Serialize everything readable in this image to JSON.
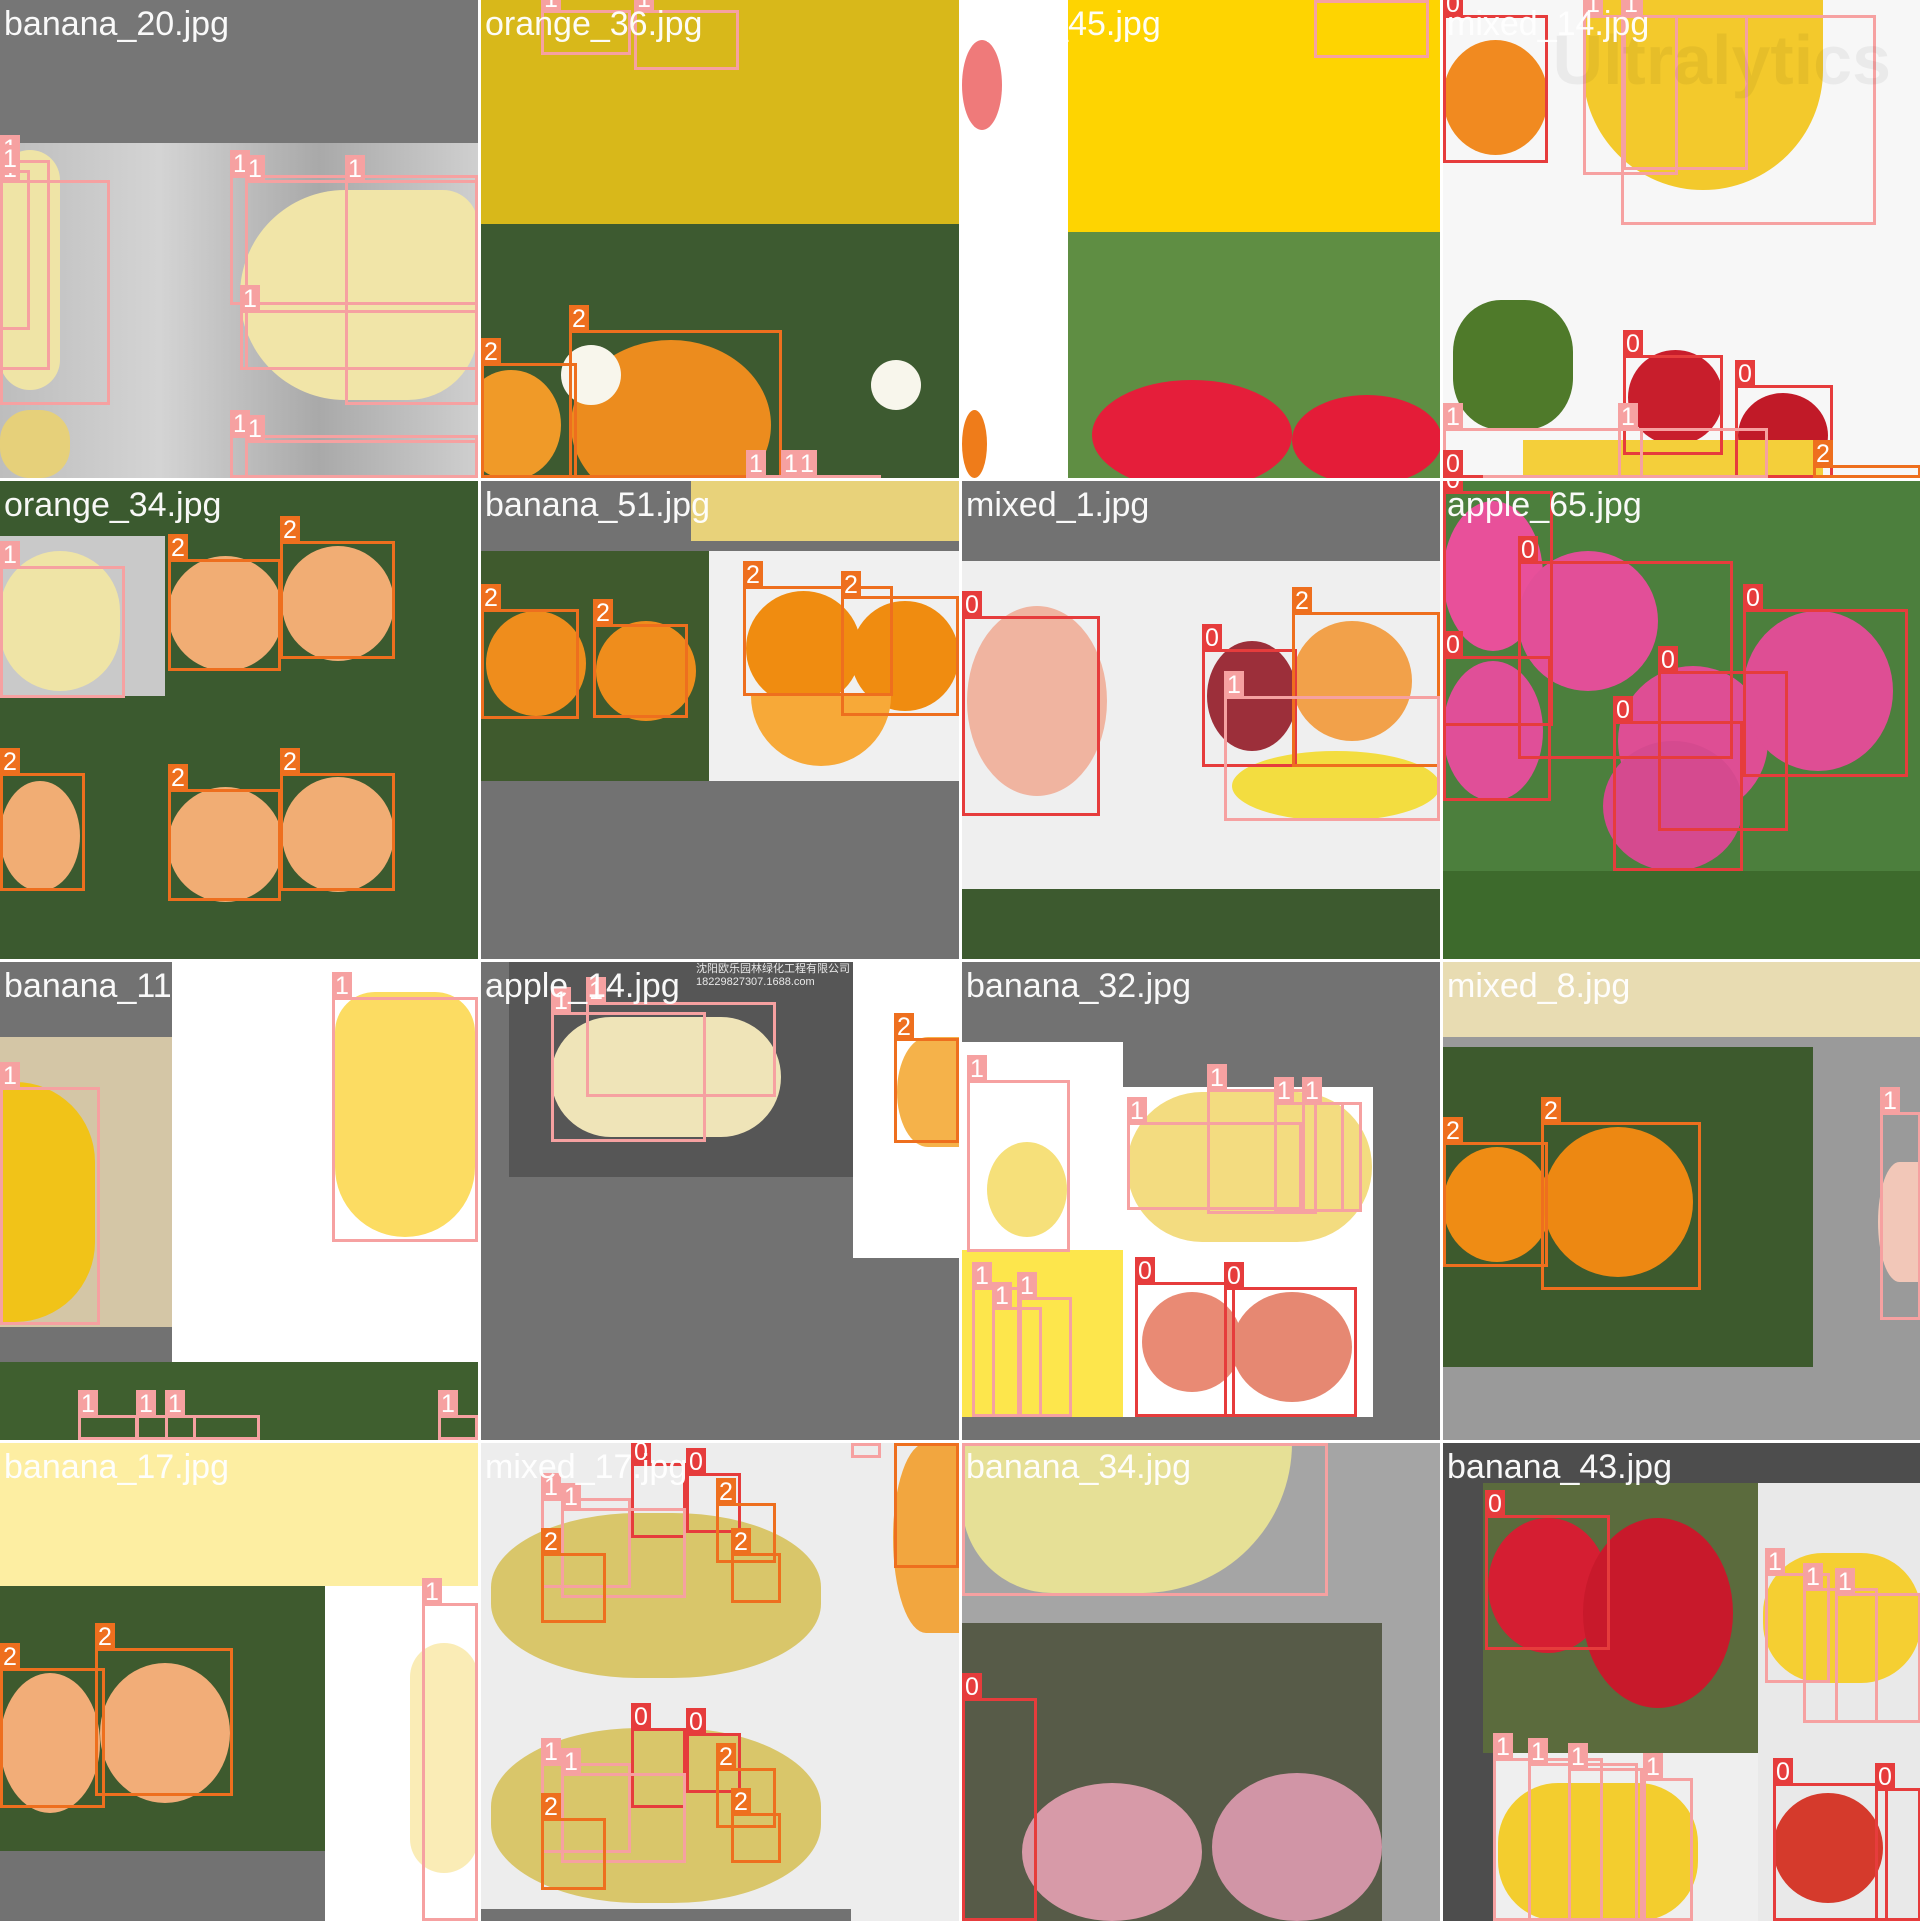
{
  "mosaic": {
    "watermark": "Ultralytics",
    "class_colors": {
      "0": "#e63c3c",
      "1": "#f6a1a1",
      "2": "#ee6f1e"
    },
    "tiles": [
      {
        "title": "banana_20.jpg",
        "labels": [
          "1",
          "1",
          "1",
          "1",
          "1",
          "1",
          "1",
          "1",
          "1"
        ]
      },
      {
        "title": "orange_36.jpg",
        "labels": [
          "1",
          "1",
          "2",
          "2",
          "1",
          "1",
          "1"
        ]
      },
      {
        "title": "apple_45.jpg",
        "labels": [
          "1"
        ]
      },
      {
        "title": "mixed_14.jpg",
        "labels": [
          "0",
          "1",
          "1",
          "1",
          "0",
          "0",
          "1",
          "1",
          "2",
          "0"
        ]
      },
      {
        "title": "orange_34.jpg",
        "labels": [
          "1",
          "2",
          "2",
          "2",
          "2",
          "2"
        ]
      },
      {
        "title": "banana_51.jpg",
        "labels": [
          "2",
          "2",
          "2",
          "2"
        ]
      },
      {
        "title": "mixed_1.jpg",
        "labels": [
          "0",
          "0",
          "2",
          "1"
        ]
      },
      {
        "title": "apple_65.jpg",
        "labels": [
          "0",
          "0",
          "0",
          "0",
          "0",
          "0"
        ]
      },
      {
        "title": "banana_11.jpg",
        "labels": [
          "1",
          "1",
          "1",
          "1",
          "1",
          "1"
        ]
      },
      {
        "title": "apple_14.jpg",
        "sign_line1": "沈阳欧乐园林绿化工程有限公司",
        "sign_line2": "18229827307.1688.com",
        "labels": [
          "1",
          "1",
          "2"
        ]
      },
      {
        "title": "banana_32.jpg",
        "labels": [
          "1",
          "1",
          "1",
          "1",
          "1",
          "1",
          "1",
          "1",
          "0",
          "0"
        ]
      },
      {
        "title": "mixed_8.jpg",
        "labels": [
          "2",
          "2",
          "1"
        ]
      },
      {
        "title": "banana_17.jpg",
        "labels": [
          "2",
          "2",
          "1"
        ]
      },
      {
        "title": "mixed_17.jpg",
        "labels": [
          "0",
          "0",
          "1",
          "1",
          "2",
          "2",
          "2",
          "0",
          "0",
          "1",
          "1",
          "2",
          "2",
          "2",
          "2",
          "1"
        ]
      },
      {
        "title": "banana_34.jpg",
        "labels": [
          "1",
          "0"
        ]
      },
      {
        "title": "banana_43.jpg",
        "labels": [
          "0",
          "1",
          "1",
          "1",
          "1",
          "1",
          "1",
          "1",
          "0",
          "0"
        ]
      }
    ]
  }
}
